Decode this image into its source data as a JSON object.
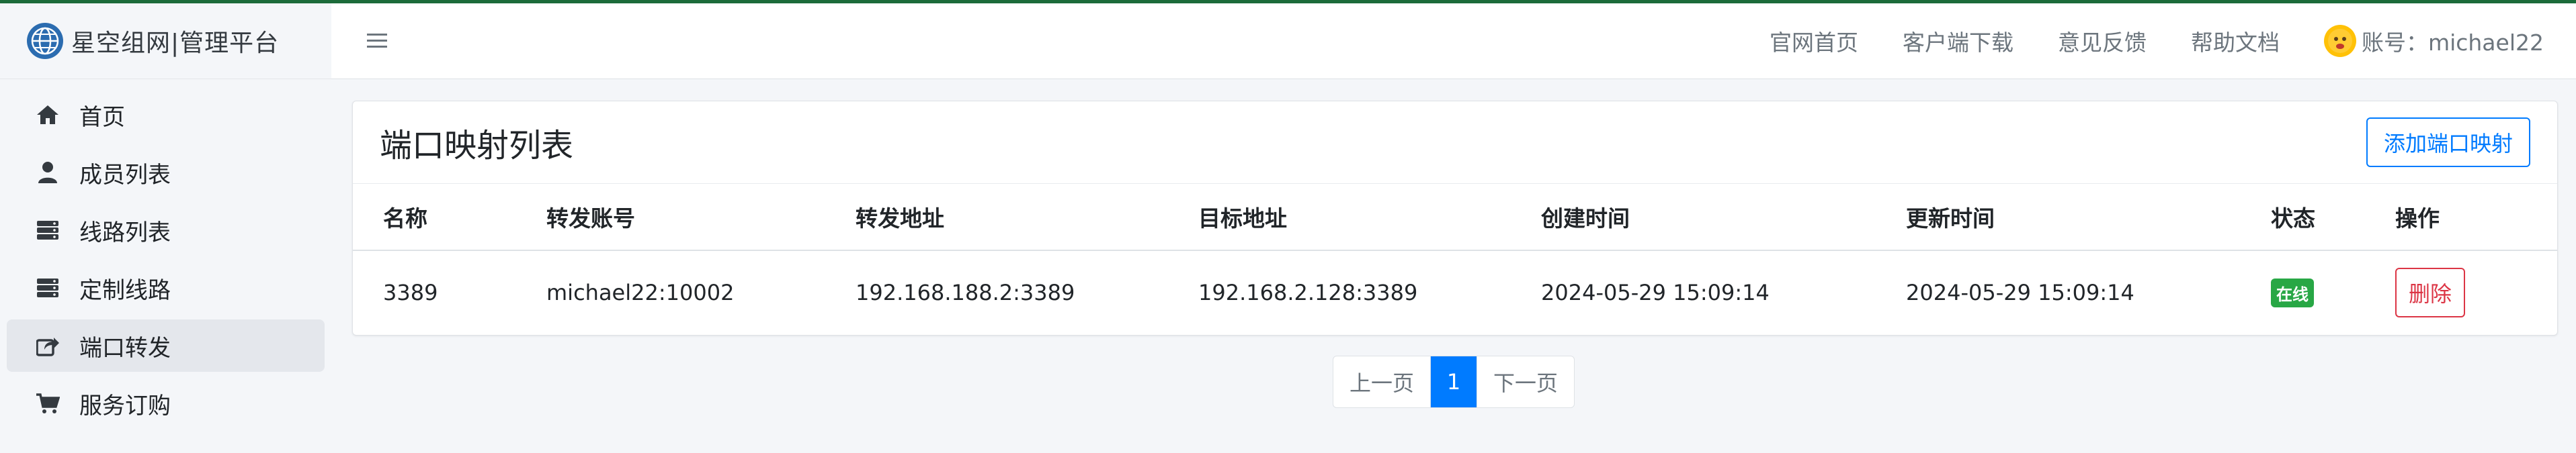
{
  "app": {
    "title": "星空组网|管理平台"
  },
  "sidebar": {
    "items": [
      {
        "label": "首页",
        "icon": "home-icon",
        "active": false
      },
      {
        "label": "成员列表",
        "icon": "user-icon",
        "active": false
      },
      {
        "label": "线路列表",
        "icon": "server-icon",
        "active": false
      },
      {
        "label": "定制线路",
        "icon": "server-icon",
        "active": false
      },
      {
        "label": "端口转发",
        "icon": "share-icon",
        "active": true
      },
      {
        "label": "服务订购",
        "icon": "cart-icon",
        "active": false
      }
    ]
  },
  "header": {
    "links": [
      "官网首页",
      "客户端下载",
      "意见反馈",
      "帮助文档"
    ],
    "account_label": "账号：michael22"
  },
  "main": {
    "card_title": "端口映射列表",
    "add_button": "添加端口映射",
    "table": {
      "columns": [
        "名称",
        "转发账号",
        "转发地址",
        "目标地址",
        "创建时间",
        "更新时间",
        "状态",
        "操作"
      ],
      "rows": [
        {
          "name": "3389",
          "account": "michael22:10002",
          "forward_addr": "192.168.188.2:3389",
          "target_addr": "192.168.2.128:3389",
          "created": "2024-05-29 15:09:14",
          "updated": "2024-05-29 15:09:14",
          "status": "在线",
          "action": "删除"
        }
      ]
    },
    "pagination": {
      "prev": "上一页",
      "current": "1",
      "next": "下一页"
    }
  },
  "colors": {
    "primary": "#007bff",
    "success": "#28a745",
    "danger": "#dc3545",
    "topline": "#1c6b3a"
  }
}
